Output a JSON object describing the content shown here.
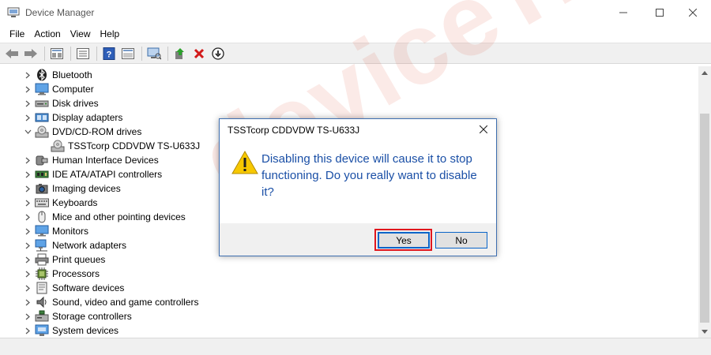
{
  "window": {
    "title": "Device Manager",
    "minimize_glyph": "—",
    "maximize_glyph": "☐",
    "close_glyph": "✕"
  },
  "menu": [
    {
      "label": "File"
    },
    {
      "label": "Action"
    },
    {
      "label": "View"
    },
    {
      "label": "Help"
    }
  ],
  "toolbar": {
    "icons": [
      "back-icon",
      "forward-icon",
      "properties-icon",
      "show-hidden-icon",
      "help-icon",
      "details-icon",
      "scan-hardware-icon",
      "update-driver-icon",
      "uninstall-icon",
      "disable-icon"
    ]
  },
  "tree": [
    {
      "label": "Bluetooth",
      "icon": "bluetooth-icon",
      "expanded": false,
      "level": 0
    },
    {
      "label": "Computer",
      "icon": "computer-icon",
      "expanded": false,
      "level": 0
    },
    {
      "label": "Disk drives",
      "icon": "disk-drive-icon",
      "expanded": false,
      "level": 0
    },
    {
      "label": "Display adapters",
      "icon": "display-adapter-icon",
      "expanded": false,
      "level": 0
    },
    {
      "label": "DVD/CD-ROM drives",
      "icon": "dvd-drive-icon",
      "expanded": true,
      "level": 0
    },
    {
      "label": "TSSTcorp CDDVDW TS-U633J",
      "icon": "dvd-device-icon",
      "expanded": null,
      "level": 1
    },
    {
      "label": "Human Interface Devices",
      "icon": "hid-icon",
      "expanded": false,
      "level": 0
    },
    {
      "label": "IDE ATA/ATAPI controllers",
      "icon": "ide-controller-icon",
      "expanded": false,
      "level": 0
    },
    {
      "label": "Imaging devices",
      "icon": "camera-icon",
      "expanded": false,
      "level": 0
    },
    {
      "label": "Keyboards",
      "icon": "keyboard-icon",
      "expanded": false,
      "level": 0
    },
    {
      "label": "Mice and other pointing devices",
      "icon": "mouse-icon",
      "expanded": false,
      "level": 0
    },
    {
      "label": "Monitors",
      "icon": "monitor-icon",
      "expanded": false,
      "level": 0
    },
    {
      "label": "Network adapters",
      "icon": "network-adapter-icon",
      "expanded": false,
      "level": 0
    },
    {
      "label": "Print queues",
      "icon": "printer-icon",
      "expanded": false,
      "level": 0
    },
    {
      "label": "Processors",
      "icon": "processor-icon",
      "expanded": false,
      "level": 0
    },
    {
      "label": "Software devices",
      "icon": "software-device-icon",
      "expanded": false,
      "level": 0
    },
    {
      "label": "Sound, video and game controllers",
      "icon": "speaker-icon",
      "expanded": false,
      "level": 0
    },
    {
      "label": "Storage controllers",
      "icon": "storage-controller-icon",
      "expanded": false,
      "level": 0
    },
    {
      "label": "System devices",
      "icon": "system-device-icon",
      "expanded": false,
      "level": 0
    }
  ],
  "dialog": {
    "title": "TSSTcorp CDDVDW TS-U633J",
    "message": "Disabling this device will cause it to stop functioning. Do you really want to disable it?",
    "yes_label": "Yes",
    "no_label": "No",
    "close_glyph": "✕"
  },
  "watermark": "deviceTricks",
  "colors": {
    "message_text": "#1a4fa6",
    "highlight": "#e0171e",
    "focus_border": "#0a64c8"
  }
}
